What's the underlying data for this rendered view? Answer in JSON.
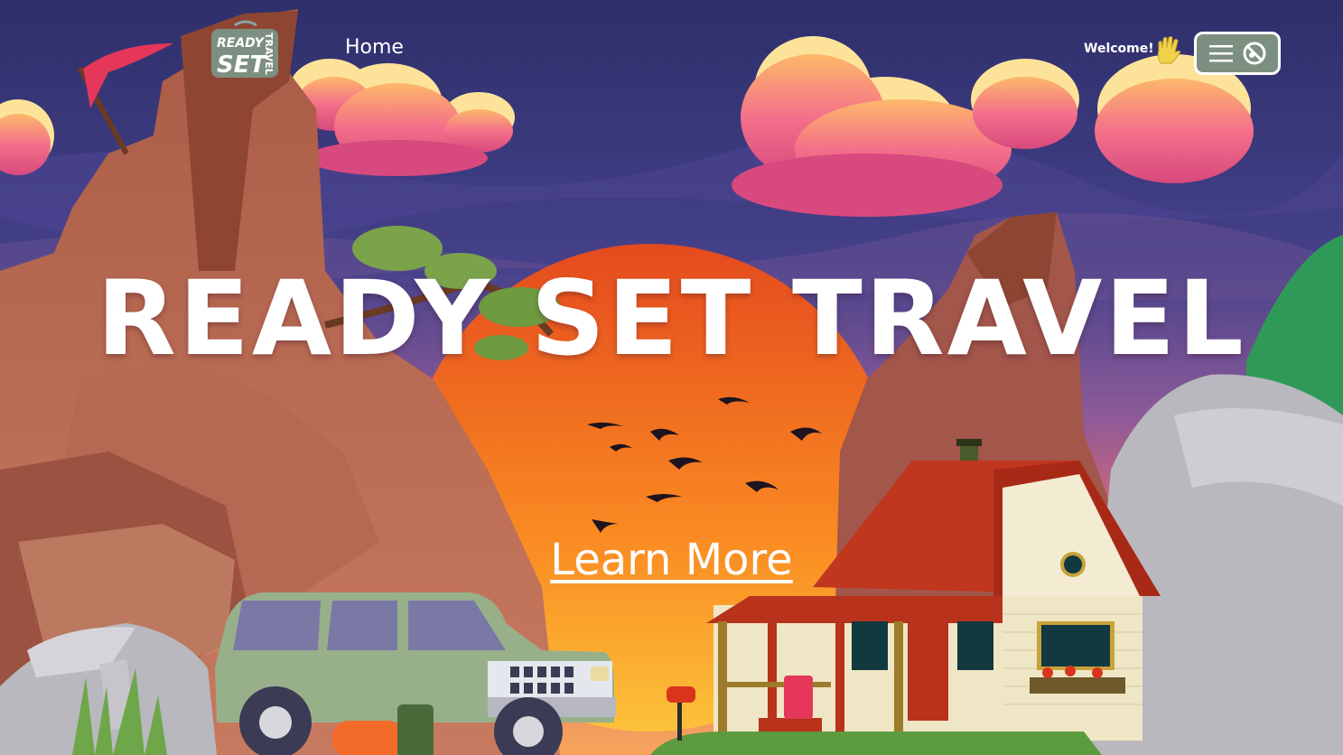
{
  "brand": {
    "logo_line1": "READY",
    "logo_line2": "SET",
    "logo_line3": "TRAVEL"
  },
  "nav": {
    "home_label": "Home",
    "welcome_label": "Welcome!",
    "wave_icon": "waving-hand-icon",
    "menu_icons": [
      "hamburger-menu-icon",
      "no-symbol-icon"
    ]
  },
  "hero": {
    "title": "READY SET TRAVEL",
    "cta_label": "Learn More"
  },
  "colors": {
    "sky_top": "#2e2f6b",
    "sky_mid": "#6a4f92",
    "sun": "#f06a2a",
    "cloud_pink": "#f0608a",
    "cloud_yellow": "#fde39a",
    "rock": "#b06a50",
    "menu_bg": "#7d8f80",
    "logo_bg": "#7d8f80",
    "car": "#98b08a",
    "house_roof": "#c0361e"
  }
}
